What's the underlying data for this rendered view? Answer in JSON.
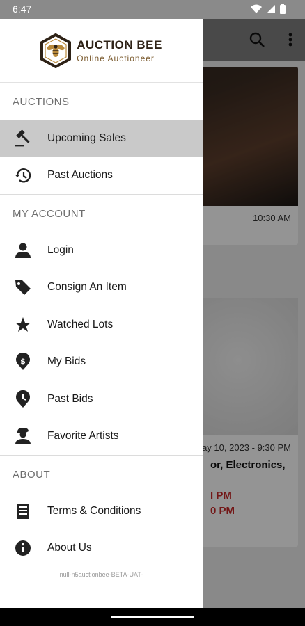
{
  "status_bar": {
    "time": "6:47"
  },
  "drawer": {
    "logo": {
      "title": "AUCTION BEE",
      "subtitle": "Online Auctioneer"
    },
    "sections": [
      {
        "header": "AUCTIONS",
        "items": [
          {
            "label": "Upcoming Sales",
            "icon": "gavel-icon",
            "active": true
          },
          {
            "label": "Past Auctions",
            "icon": "history-icon",
            "active": false
          }
        ]
      },
      {
        "header": "MY ACCOUNT",
        "items": [
          {
            "label": "Login",
            "icon": "person-icon"
          },
          {
            "label": "Consign An Item",
            "icon": "tag-icon"
          },
          {
            "label": "Watched Lots",
            "icon": "star-icon"
          },
          {
            "label": "My Bids",
            "icon": "dollar-pin-icon"
          },
          {
            "label": "Past Bids",
            "icon": "clock-pin-icon"
          },
          {
            "label": "Favorite Artists",
            "icon": "artist-icon"
          }
        ]
      },
      {
        "header": "ABOUT",
        "items": [
          {
            "label": "Terms & Conditions",
            "icon": "document-icon"
          },
          {
            "label": "About Us",
            "icon": "info-icon"
          }
        ]
      }
    ],
    "version": "null-n5auctionbee-BETA-UAT-"
  },
  "background": {
    "card1_time": "10:30 AM",
    "card2_date": "ay 10, 2023 - 9:30 PM",
    "card2_title": "or, Electronics,",
    "card2_red1": "I PM",
    "card2_red2": "0 PM"
  },
  "colors": {
    "brand": "#2e2216",
    "accent_gold": "#b98a3c",
    "red": "#c62828"
  }
}
